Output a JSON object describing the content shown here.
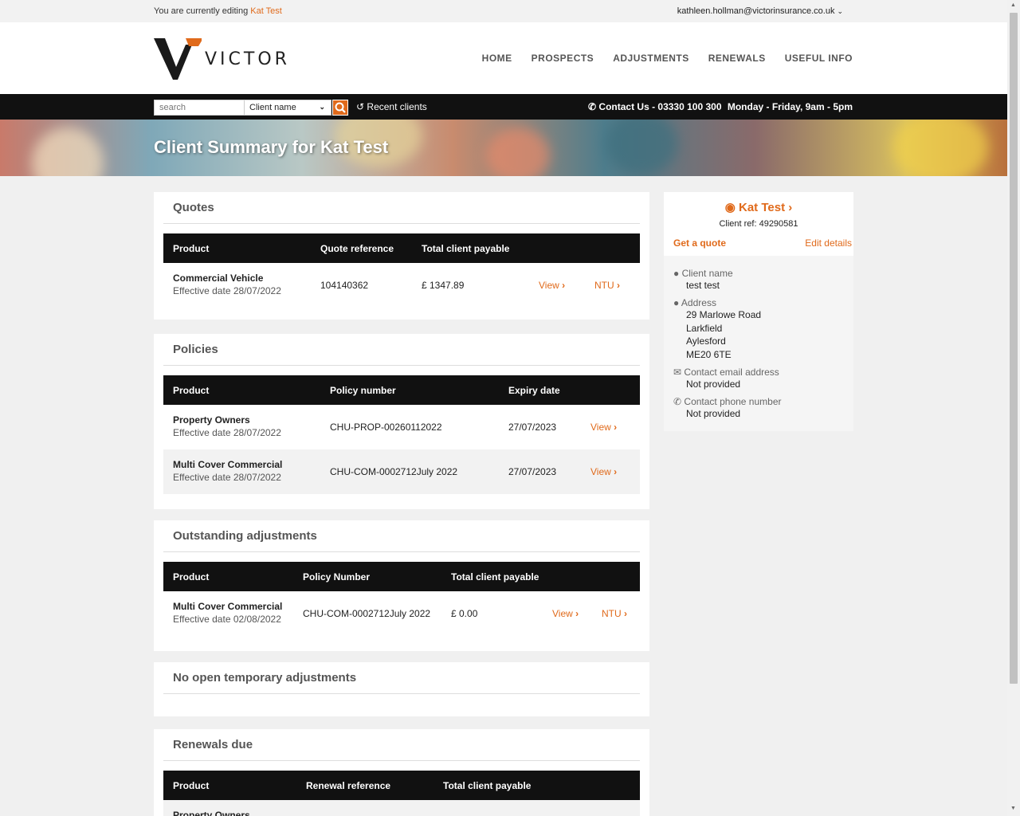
{
  "topbar": {
    "editing_prefix": "You are currently editing",
    "editing_client": "Kat Test",
    "user_email": "kathleen.hollman@victorinsurance.co.uk"
  },
  "brand": {
    "logo_text": "VICTOR",
    "accent": "#e06a1b"
  },
  "nav": [
    "HOME",
    "PROSPECTS",
    "ADJUSTMENTS",
    "RENEWALS",
    "USEFUL INFO"
  ],
  "searchbar": {
    "placeholder": "search",
    "select_value": "Client name",
    "recent_label": "Recent clients",
    "contact_label": "Contact Us - 03330 100 300",
    "hours": "Monday - Friday, 9am - 5pm"
  },
  "banner": {
    "title": "Client Summary for Kat Test"
  },
  "quotes": {
    "title": "Quotes",
    "headers": [
      "Product",
      "Quote reference",
      "Total client payable"
    ],
    "rows": [
      {
        "product": "Commercial Vehicle",
        "effective": "Effective date 28/07/2022",
        "ref": "104140362",
        "total": "£ 1347.89",
        "view": "View",
        "ntu": "NTU"
      }
    ]
  },
  "policies": {
    "title": "Policies",
    "headers": [
      "Product",
      "Policy number",
      "Expiry date"
    ],
    "rows": [
      {
        "product": "Property Owners",
        "effective": "Effective date 28/07/2022",
        "number": "CHU-PROP-00260112022",
        "expiry": "27/07/2023",
        "view": "View"
      },
      {
        "product": "Multi Cover Commercial",
        "effective": "Effective date 28/07/2022",
        "number": "CHU-COM-0002712July 2022",
        "expiry": "27/07/2023",
        "view": "View"
      }
    ]
  },
  "adjustments": {
    "title": "Outstanding adjustments",
    "headers": [
      "Product",
      "Policy Number",
      "Total client payable"
    ],
    "rows": [
      {
        "product": "Multi Cover Commercial",
        "effective": "Effective date 02/08/2022",
        "number": "CHU-COM-0002712July 2022",
        "total": "£ 0.00",
        "view": "View",
        "ntu": "NTU"
      }
    ]
  },
  "temporary": {
    "title": "No open temporary adjustments"
  },
  "renewals": {
    "title": "Renewals due",
    "headers": [
      "Product",
      "Renewal reference",
      "Total client payable"
    ],
    "rows": [
      {
        "product": "Property Owners"
      }
    ]
  },
  "client": {
    "name": "Kat Test",
    "ref": "Client ref: 49290581",
    "get_quote": "Get a quote",
    "edit_details": "Edit details",
    "name_label": "Client name",
    "name_value": "test test",
    "address_label": "Address",
    "address_lines": [
      "29 Marlowe Road",
      "Larkfield",
      "Aylesford",
      "ME20 6TE"
    ],
    "email_label": "Contact email address",
    "email_value": "Not provided",
    "phone_label": "Contact phone number",
    "phone_value": "Not provided"
  }
}
